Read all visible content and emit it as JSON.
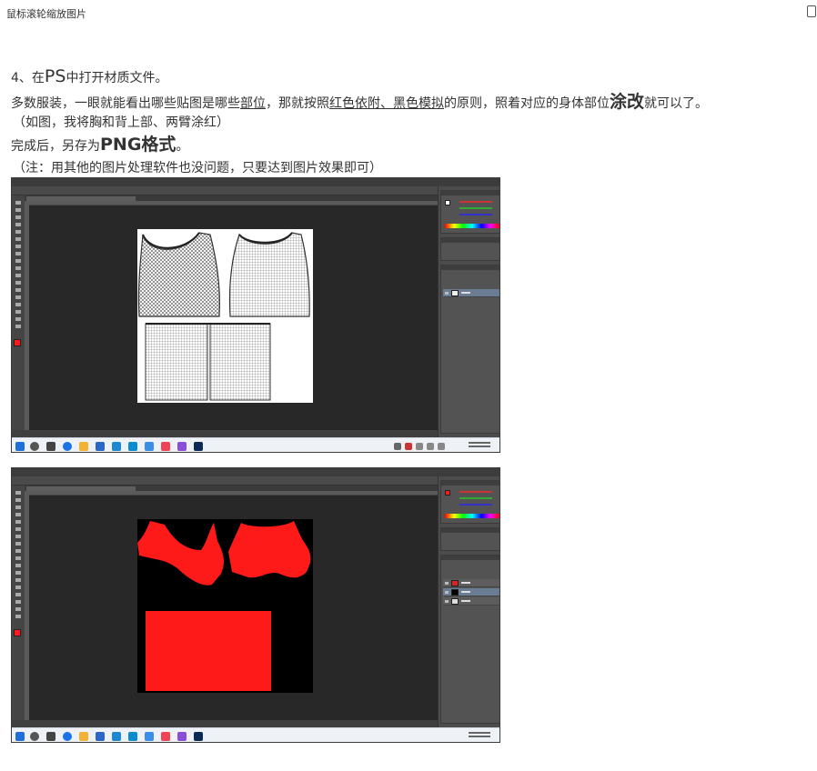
{
  "page": {
    "hint_text": "鼠标滚轮缩放图片"
  },
  "article": {
    "step_prefix": "4、在",
    "step_ps": "PS",
    "step_suffix": "中打开材质文件。",
    "para_a": "多数服装，一眼就能看出哪些贴图是哪些",
    "para_u1": "部位",
    "para_b": "，那就按照",
    "para_u2": "红色依附、黑色模拟",
    "para_c": "的原则，照着对应的身体部位",
    "para_bold": "涂改",
    "para_d": "就可以了。",
    "note1": "（如图，我将胸和背上部、两臂涂红）",
    "save_prefix": "完成后，另存为",
    "save_bold": "PNG格式",
    "save_suffix": "。",
    "note2": "（注：用其他的图片处理软件也没问题，只要达到图片效果即可）"
  },
  "colors": {
    "ps_bg": "#535353",
    "ps_canvas": "#282828",
    "paint_red": "#ff1a1a",
    "mesh_gray": "#555555"
  },
  "screenshots": [
    {
      "id": "photoshop-original-texture",
      "layers": [
        "背景"
      ],
      "canvas_fill": "white"
    },
    {
      "id": "photoshop-painted-texture",
      "layers": [
        "图层 2",
        "图层 1",
        "背景"
      ],
      "canvas_fill": "black"
    }
  ]
}
